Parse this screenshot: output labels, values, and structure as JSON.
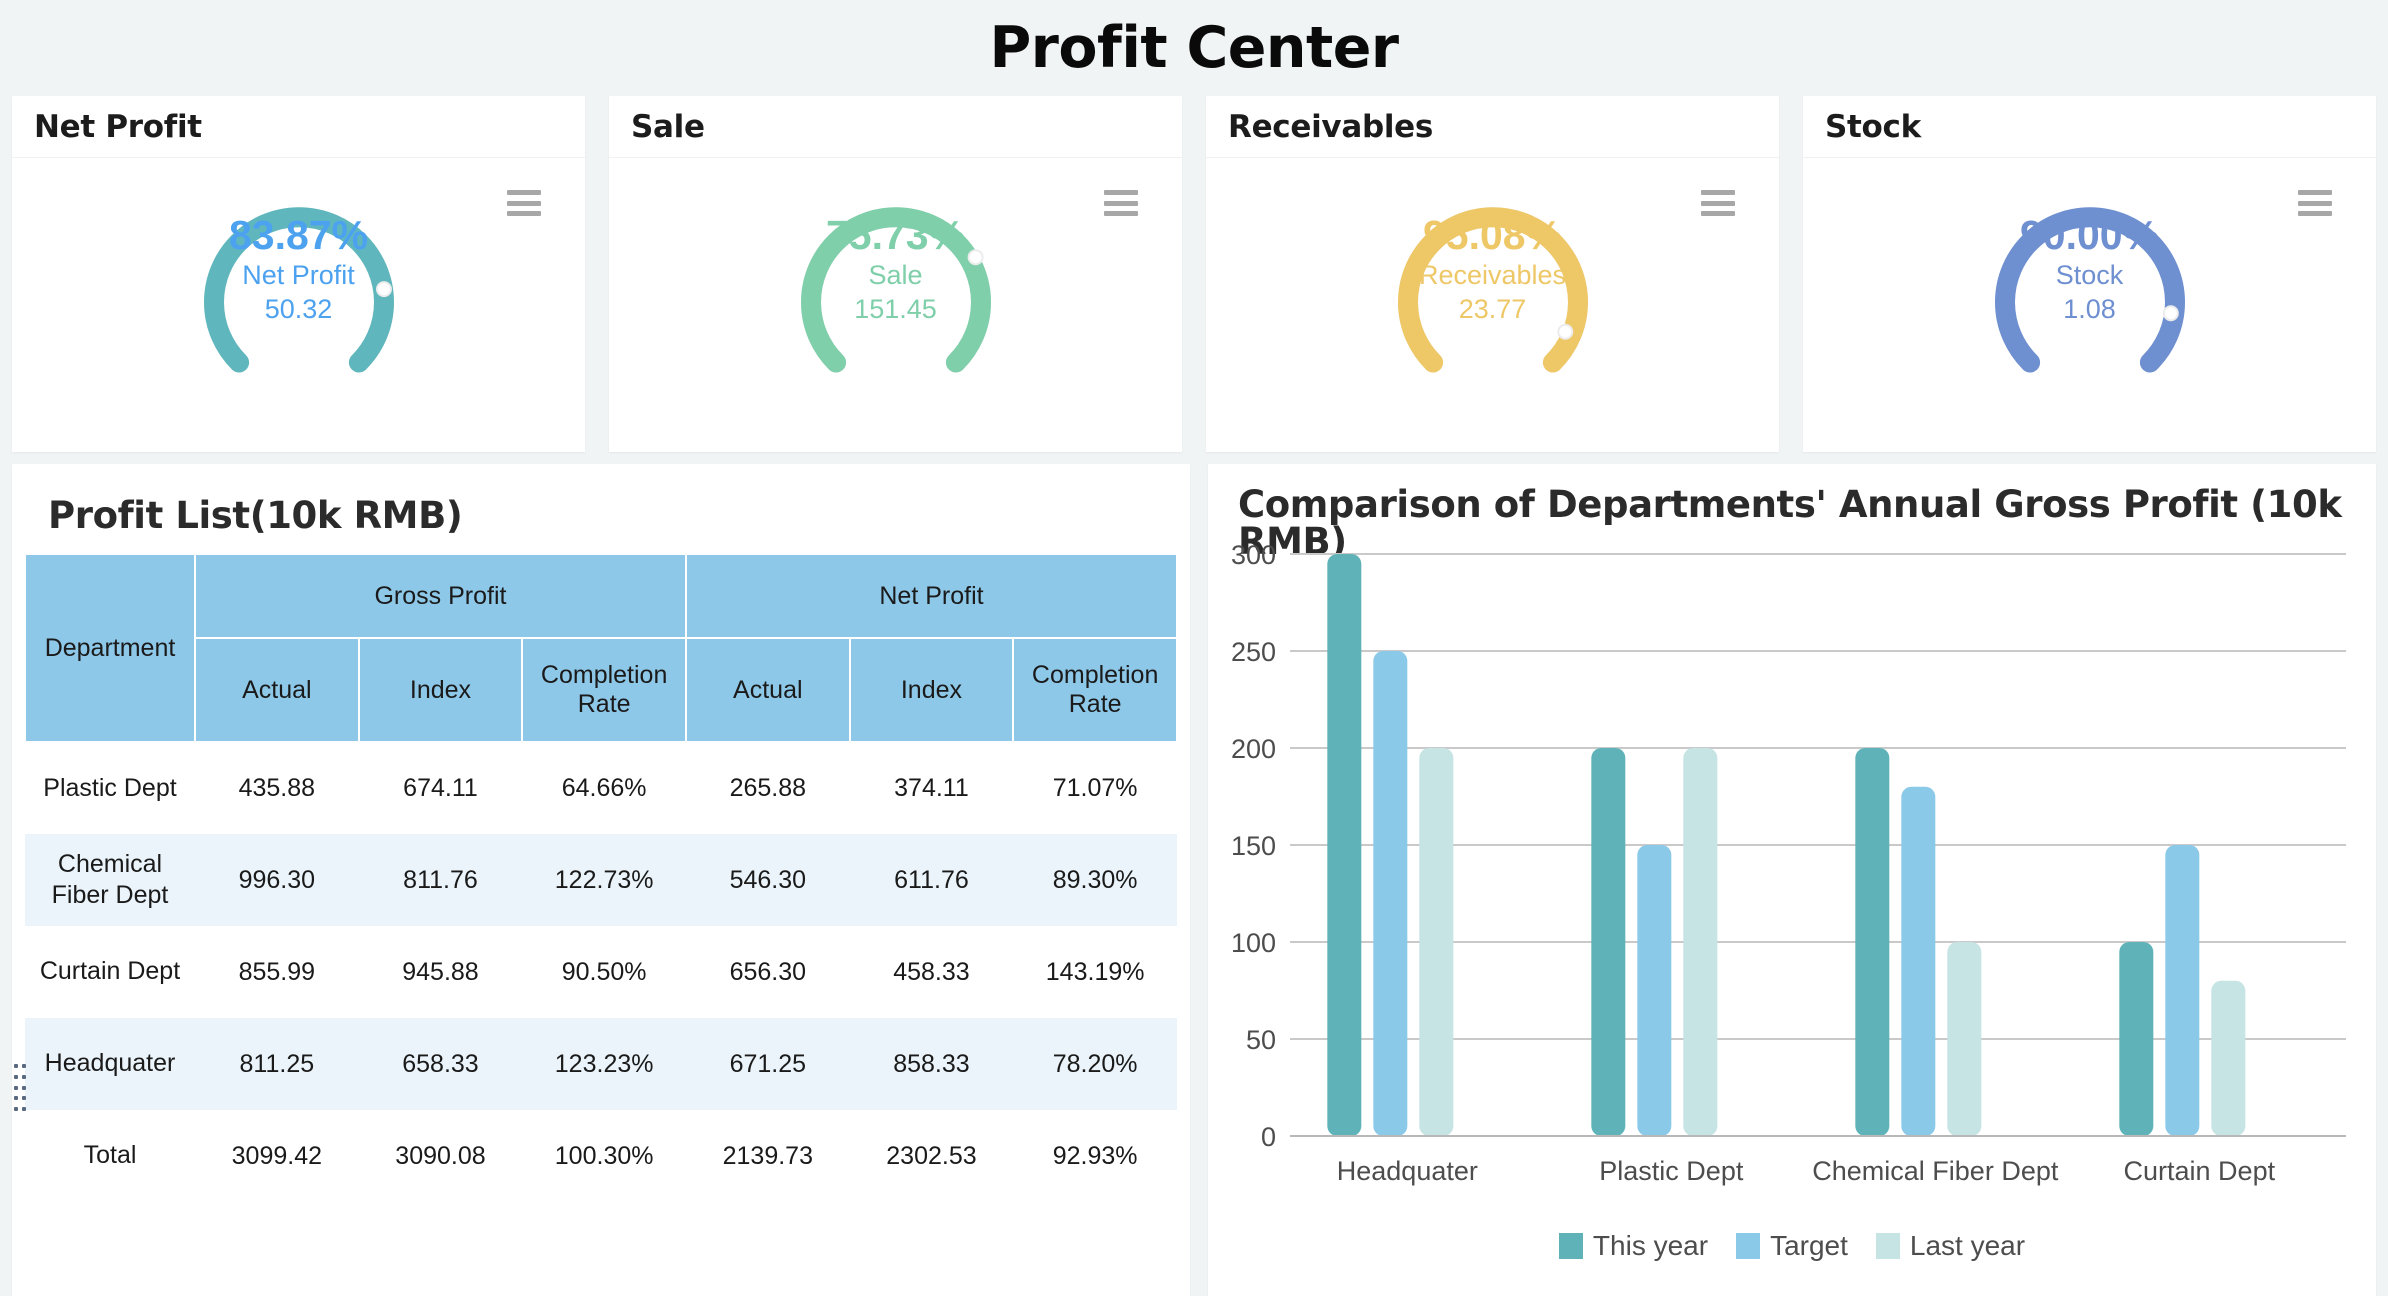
{
  "header": {
    "title": "Profit Center"
  },
  "kpis": [
    {
      "title": "Net Profit",
      "percent": "83.87%",
      "name": "Net Profit",
      "value": "50.32",
      "ratio": 0.8387,
      "color": "#5fb7bd",
      "text_color": "#4da2f0",
      "menu_icon": "hamburger-menu-icon"
    },
    {
      "title": "Sale",
      "percent": "75.73%",
      "name": "Sale",
      "value": "151.45",
      "ratio": 0.7573,
      "color": "#7fcfaa",
      "text_color": "#7fcfaa",
      "menu_icon": "hamburger-menu-icon"
    },
    {
      "title": "Receivables",
      "percent": "95.08%",
      "name": "Receivables",
      "value": "23.77",
      "ratio": 0.9508,
      "color": "#eec767",
      "text_color": "#eec767",
      "menu_icon": "hamburger-menu-icon"
    },
    {
      "title": "Stock",
      "percent": "90.00%",
      "name": "Stock",
      "value": "1.08",
      "ratio": 0.9,
      "color": "#6e8fd0",
      "text_color": "#6e8fd0",
      "menu_icon": "hamburger-menu-icon"
    }
  ],
  "table_panel": {
    "title": "Profit List(10k RMB)",
    "headers": {
      "department": "Department",
      "gross_profit": "Gross Profit",
      "net_profit": "Net Profit",
      "actual": "Actual",
      "index": "Index",
      "completion_rate": "Completion Rate"
    },
    "rows": [
      {
        "department": "Plastic Dept",
        "gross_actual": "435.88",
        "gross_index": "674.11",
        "gross_rate": "64.66%",
        "gross_rate_tone": "neg",
        "net_actual": "265.88",
        "net_index": "374.11",
        "net_rate": "71.07%",
        "net_rate_tone": "neg"
      },
      {
        "department": "Chemical Fiber Dept",
        "gross_actual": "996.30",
        "gross_index": "811.76",
        "gross_rate": "122.73%",
        "gross_rate_tone": "pos",
        "net_actual": "546.30",
        "net_index": "611.76",
        "net_rate": "89.30%",
        "net_rate_tone": "neg"
      },
      {
        "department": "Curtain Dept",
        "gross_actual": "855.99",
        "gross_index": "945.88",
        "gross_rate": "90.50%",
        "gross_rate_tone": "neg",
        "net_actual": "656.30",
        "net_index": "458.33",
        "net_rate": "143.19%",
        "net_rate_tone": "pos"
      },
      {
        "department": "Headquater",
        "gross_actual": "811.25",
        "gross_index": "658.33",
        "gross_rate": "123.23%",
        "gross_rate_tone": "pos",
        "net_actual": "671.25",
        "net_index": "858.33",
        "net_rate": "78.20%",
        "net_rate_tone": "neg"
      },
      {
        "department": "Total",
        "gross_actual": "3099.42",
        "gross_index": "3090.08",
        "gross_rate": "100.30%",
        "gross_rate_tone": "pos",
        "net_actual": "2139.73",
        "net_index": "2302.53",
        "net_rate": "92.93%",
        "net_rate_tone": "neg"
      }
    ]
  },
  "chart_panel": {
    "title": "Comparison of Departments' Annual Gross Profit (10k RMB)"
  },
  "chart_data": {
    "type": "bar",
    "title": "Comparison of Departments' Annual Gross Profit (10k RMB)",
    "xlabel": "",
    "ylabel": "",
    "categories": [
      "Headquater",
      "Plastic Dept",
      "Chemical Fiber Dept",
      "Curtain Dept"
    ],
    "series": [
      {
        "name": "This year",
        "color": "#5fb3b8",
        "values": [
          300,
          200,
          200,
          100
        ]
      },
      {
        "name": "Target",
        "color": "#8bc9e8",
        "values": [
          250,
          150,
          180,
          150
        ]
      },
      {
        "name": "Last year",
        "color": "#c6e4e3",
        "values": [
          200,
          200,
          100,
          80
        ]
      }
    ],
    "ylim": [
      0,
      300
    ],
    "yticks": [
      0,
      50,
      100,
      150,
      200,
      250,
      300
    ],
    "grid": true,
    "legend_position": "bottom"
  }
}
